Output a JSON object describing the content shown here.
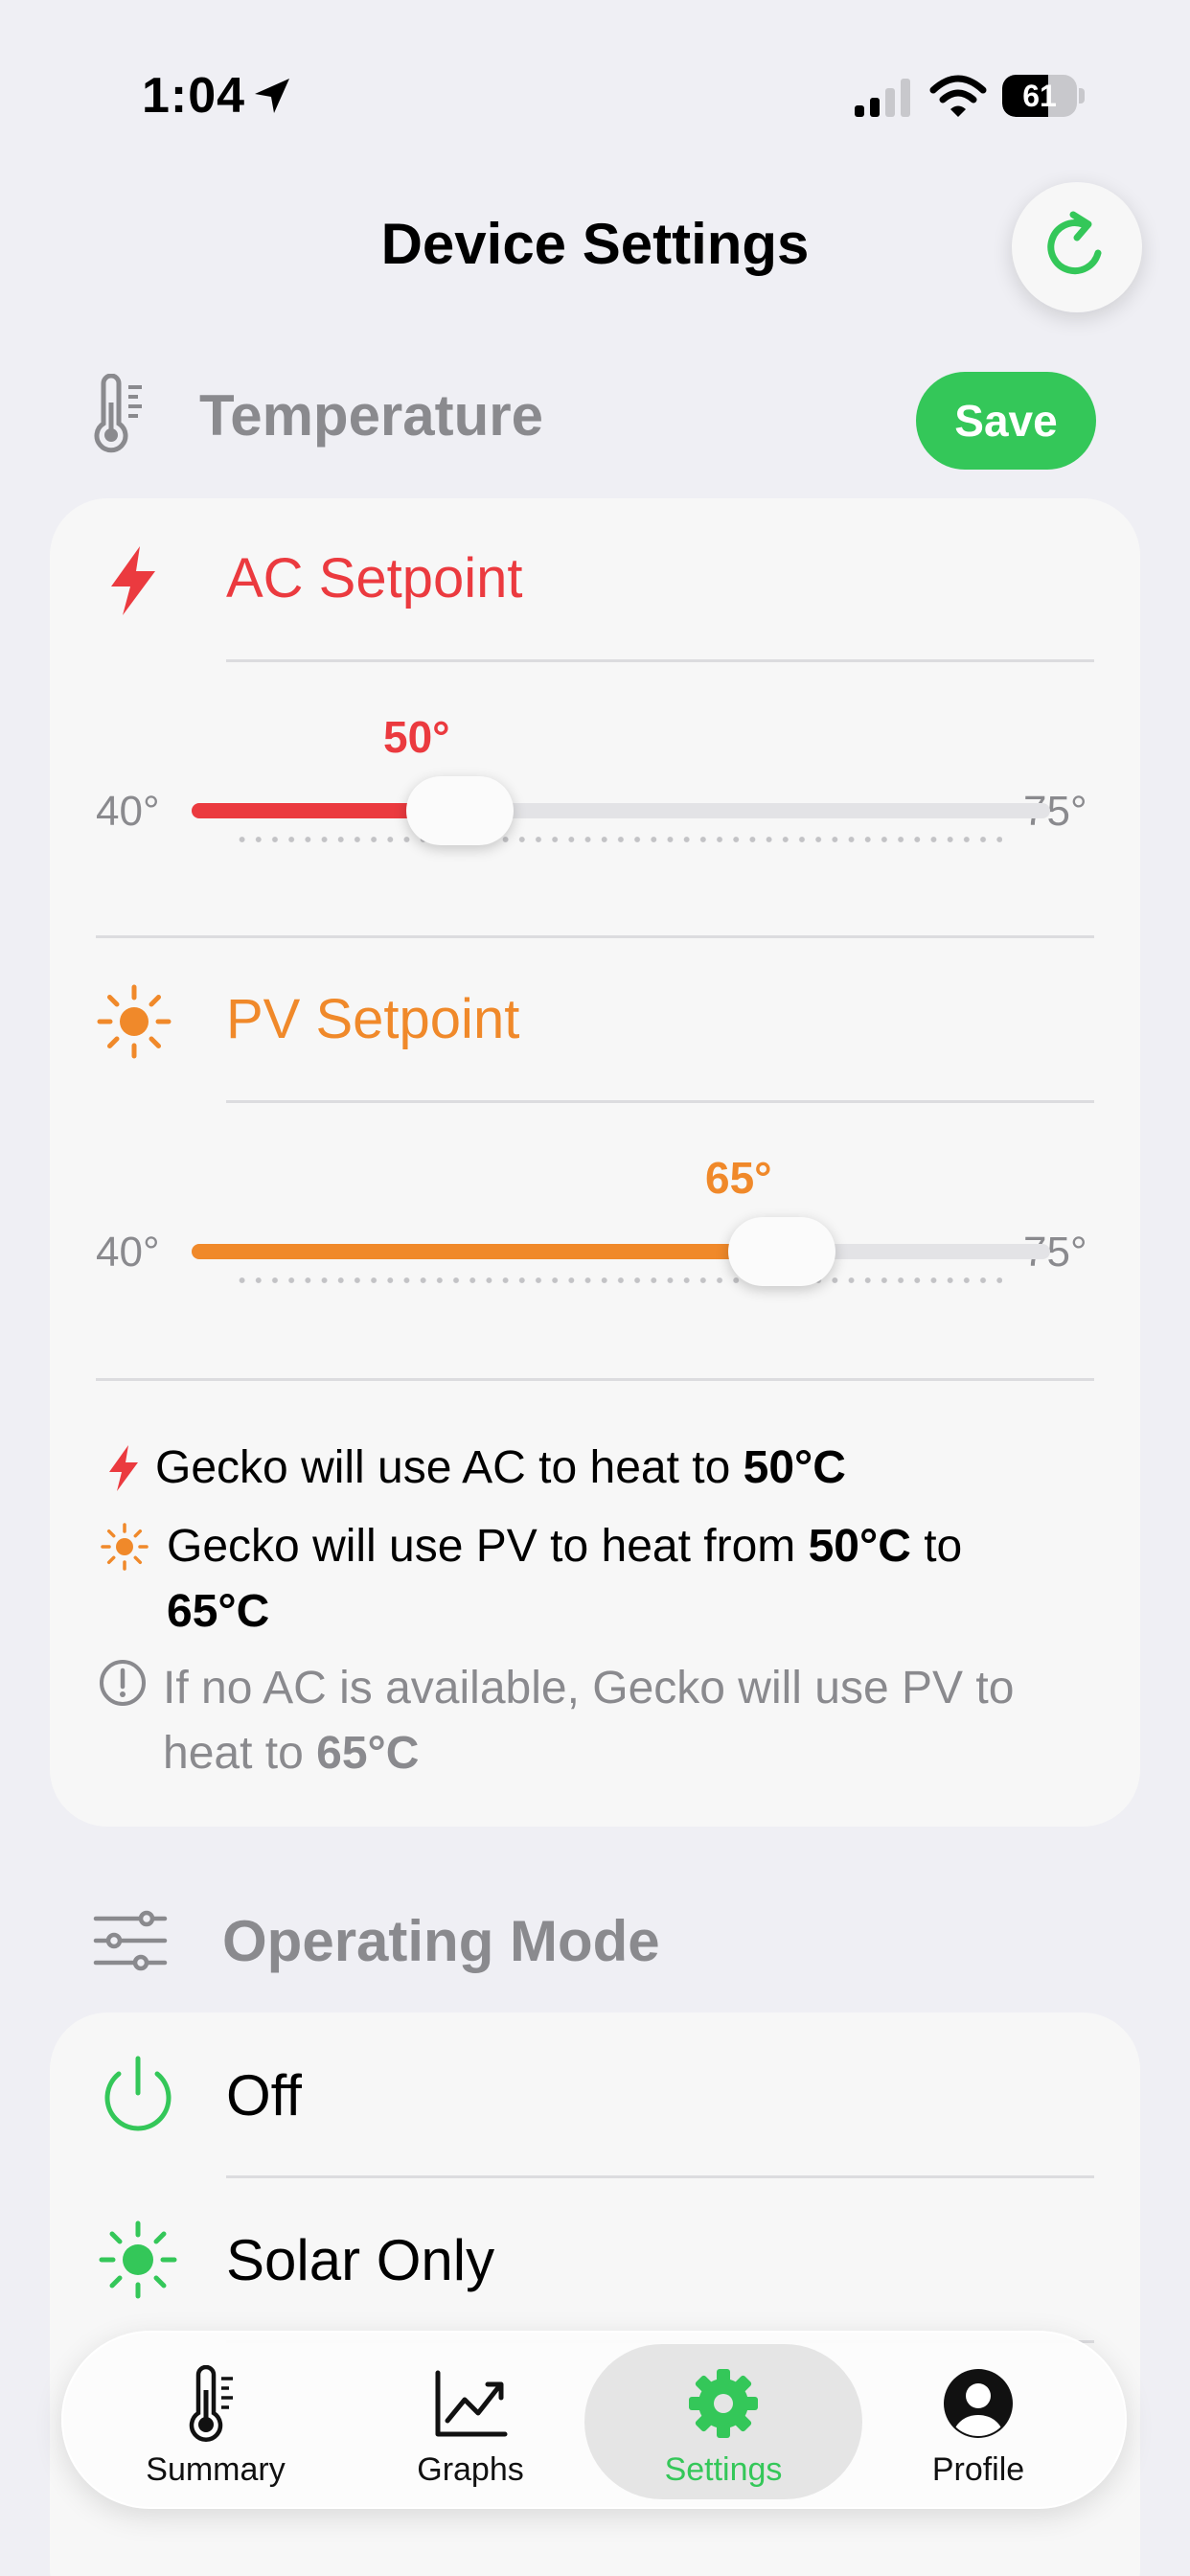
{
  "status_bar": {
    "time": "1:04",
    "battery_level": "61",
    "battery_fraction": 0.61
  },
  "header": {
    "title": "Device Settings",
    "refresh_icon": "refresh-icon"
  },
  "temperature": {
    "section_title": "Temperature",
    "save_label": "Save",
    "ac": {
      "title": "AC Setpoint",
      "min_label": "40°",
      "max_label": "75°",
      "min": 40,
      "max": 75,
      "value": 50,
      "value_label": "50°",
      "color": "#eb3a3f"
    },
    "pv": {
      "title": "PV Setpoint",
      "min_label": "40°",
      "max_label": "75°",
      "min": 40,
      "max": 75,
      "value": 65,
      "value_label": "65°",
      "color": "#f0892a"
    },
    "info": {
      "ac_prefix": "Gecko will use AC to heat to ",
      "ac_value": "50°C",
      "pv_prefix": "Gecko will use PV to heat from ",
      "pv_from": "50°C",
      "pv_mid": " to",
      "pv_to": "65°C",
      "note_prefix": "If no AC is available, Gecko will use PV to",
      "note_prefix2": "heat to ",
      "note_value": "65°C"
    }
  },
  "operating_mode": {
    "section_title": "Operating Mode",
    "items": [
      {
        "label": "Off",
        "icon": "power-icon"
      },
      {
        "label": "Solar Only",
        "icon": "sun-icon"
      }
    ]
  },
  "tab_bar": {
    "tabs": [
      {
        "label": "Summary",
        "icon": "thermometer-icon"
      },
      {
        "label": "Graphs",
        "icon": "chart-icon"
      },
      {
        "label": "Settings",
        "icon": "gear-icon"
      },
      {
        "label": "Profile",
        "icon": "person-icon"
      }
    ],
    "active": "Settings"
  },
  "colors": {
    "accent_green": "#34c759",
    "ac_red": "#eb3a3f",
    "pv_orange": "#f0892a",
    "secondary_gray": "#8a8a8e"
  }
}
